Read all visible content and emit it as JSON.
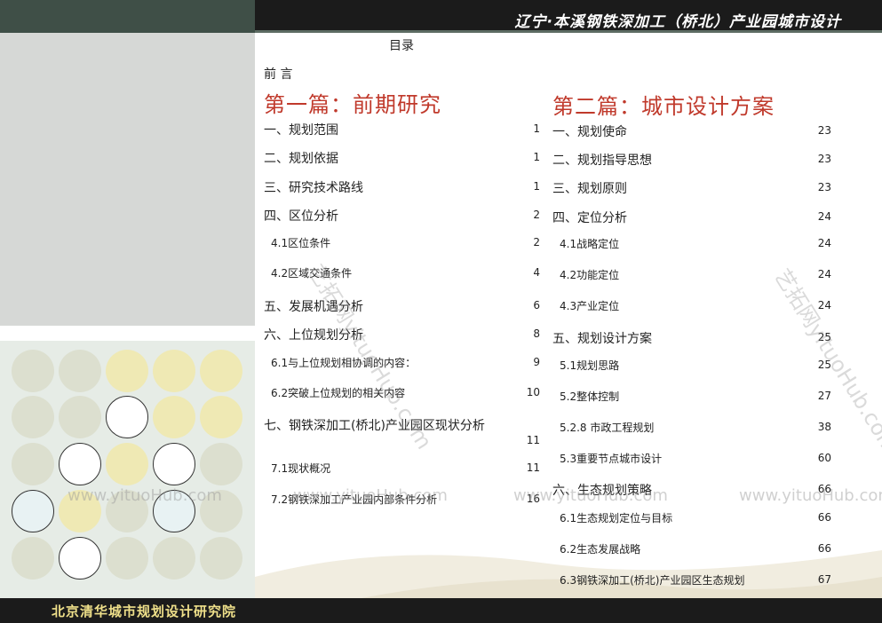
{
  "header": {
    "title": "辽宁·本溪钢铁深加工（桥北）产业园城市设计"
  },
  "footer": {
    "institute": "北京清华城市规划设计研究院"
  },
  "toc": {
    "title": "目录",
    "preface": "前 言",
    "part1": {
      "title": "第一篇：前期研究",
      "entries": [
        {
          "label": "一、规划范围",
          "page": "1"
        },
        {
          "label": "二、规划依据",
          "page": "1"
        },
        {
          "label": "三、研究技术路线",
          "page": "1"
        },
        {
          "label": "四、区位分析",
          "page": "2"
        },
        {
          "label": "4.1区位条件",
          "page": "2"
        },
        {
          "label": "4.2区域交通条件",
          "page": "4"
        },
        {
          "label": "五、发展机遇分析",
          "page": "6"
        },
        {
          "label": "六、上位规划分析",
          "page": "8"
        },
        {
          "label": "6.1与上位规划相协调的内容：",
          "page": "9"
        },
        {
          "label": "6.2突破上位规划的相关内容",
          "page": "10"
        },
        {
          "label": "七、钢铁深加工(桥北)产业园区现状分析",
          "page": "11"
        },
        {
          "label": "7.1现状概况",
          "page": "11"
        },
        {
          "label": "7.2钢铁深加工产业园内部条件分析",
          "page": "16"
        }
      ]
    },
    "part2": {
      "title": "第二篇：城市设计方案",
      "entries": [
        {
          "label": "一、规划使命",
          "page": "23"
        },
        {
          "label": "二、规划指导思想",
          "page": "23"
        },
        {
          "label": "三、规划原则",
          "page": "23"
        },
        {
          "label": "四、定位分析",
          "page": "24"
        },
        {
          "label": "4.1战略定位",
          "page": "24"
        },
        {
          "label": "4.2功能定位",
          "page": "24"
        },
        {
          "label": "4.3产业定位",
          "page": "24"
        },
        {
          "label": "五、规划设计方案",
          "page": "25"
        },
        {
          "label": "5.1规划思路",
          "page": "25"
        },
        {
          "label": "5.2整体控制",
          "page": "27"
        },
        {
          "label": "5.2.8 市政工程规划",
          "page": "38"
        },
        {
          "label": "5.3重要节点城市设计",
          "page": "60"
        },
        {
          "label": "六、生态规划策略",
          "page": "66"
        },
        {
          "label": "6.1生态规划定位与目标",
          "page": "66"
        },
        {
          "label": "6.2生态发展战略",
          "page": "66"
        },
        {
          "label": "6.3钢铁深加工(桥北)产业园区生态规划",
          "page": "67"
        }
      ]
    }
  },
  "watermark": {
    "text": "www.yituoHub.com",
    "diagonal": "艺拓网yituoHub.com"
  },
  "colors": {
    "part_title": "#c0392b",
    "header_bg": "#1b1b1b",
    "footer_text": "#efe08a"
  }
}
